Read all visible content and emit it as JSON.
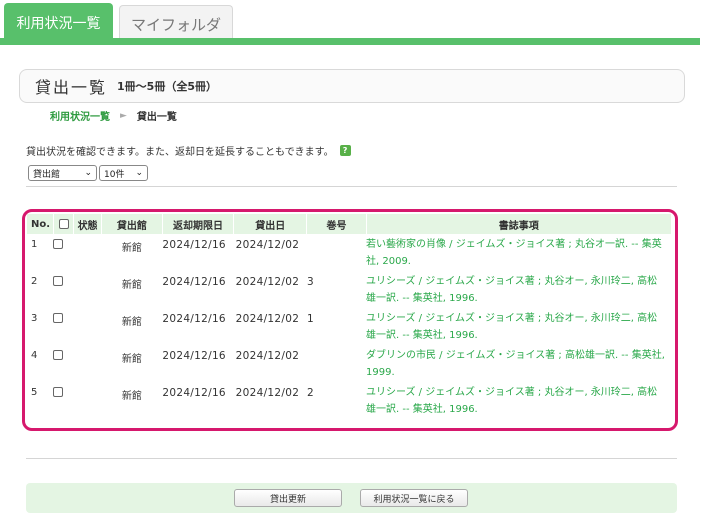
{
  "tabs": [
    {
      "label": "利用状況一覧"
    },
    {
      "label": "マイフォルダ"
    }
  ],
  "panel": {
    "title": "貸出一覧",
    "count": "1冊～5冊（全5冊）"
  },
  "breadcrumb": {
    "parent": "利用状況一覧",
    "separator": "►",
    "current": "貸出一覧"
  },
  "description": "貸出状況を確認できます。また、返却日を延長することもできます。",
  "help_icon": "?",
  "filters": {
    "library_select": "貸出館",
    "count_select": "10件"
  },
  "table": {
    "headers": [
      "No.",
      "",
      "状態",
      "貸出館",
      "返却期限日",
      "貸出日",
      "巻号",
      "書誌事項"
    ],
    "rows": [
      {
        "no": "1",
        "status": "",
        "library": "新館",
        "due": "2024/12/16",
        "lent": "2024/12/02",
        "volume": "",
        "book": "若い藝術家の肖像 / ジェイムズ・ジョイス著 ; 丸谷オ一訳. -- 集英社, 2009."
      },
      {
        "no": "2",
        "status": "",
        "library": "新館",
        "due": "2024/12/16",
        "lent": "2024/12/02",
        "volume": "3",
        "book": "ユリシーズ / ジェイムズ・ジョイス著 ; 丸谷オー, 永川玲二, 高松雄一訳. -- 集英社, 1996."
      },
      {
        "no": "3",
        "status": "",
        "library": "新館",
        "due": "2024/12/16",
        "lent": "2024/12/02",
        "volume": "1",
        "book": "ユリシーズ / ジェイムズ・ジョイス著 ; 丸谷オー, 永川玲二, 高松雄一訳. -- 集英社, 1996."
      },
      {
        "no": "4",
        "status": "",
        "library": "新館",
        "due": "2024/12/16",
        "lent": "2024/12/02",
        "volume": "",
        "book": "ダブリンの市民 / ジェイムズ・ジョイス著 ; 高松雄一訳. -- 集英社, 1999."
      },
      {
        "no": "5",
        "status": "",
        "library": "新館",
        "due": "2024/12/16",
        "lent": "2024/12/02",
        "volume": "2",
        "book": "ユリシーズ / ジェイムズ・ジョイス著 ; 丸谷オー, 永川玲二, 高松雄一訳. -- 集英社, 1996."
      }
    ]
  },
  "buttons": {
    "renew": "貸出更新",
    "back": "利用状況一覧に戻る"
  },
  "colors": {
    "accent": "#58c06b",
    "highlight_frame": "#d6186d",
    "link": "#2aa84a",
    "header_bg": "#e4f5e3"
  }
}
